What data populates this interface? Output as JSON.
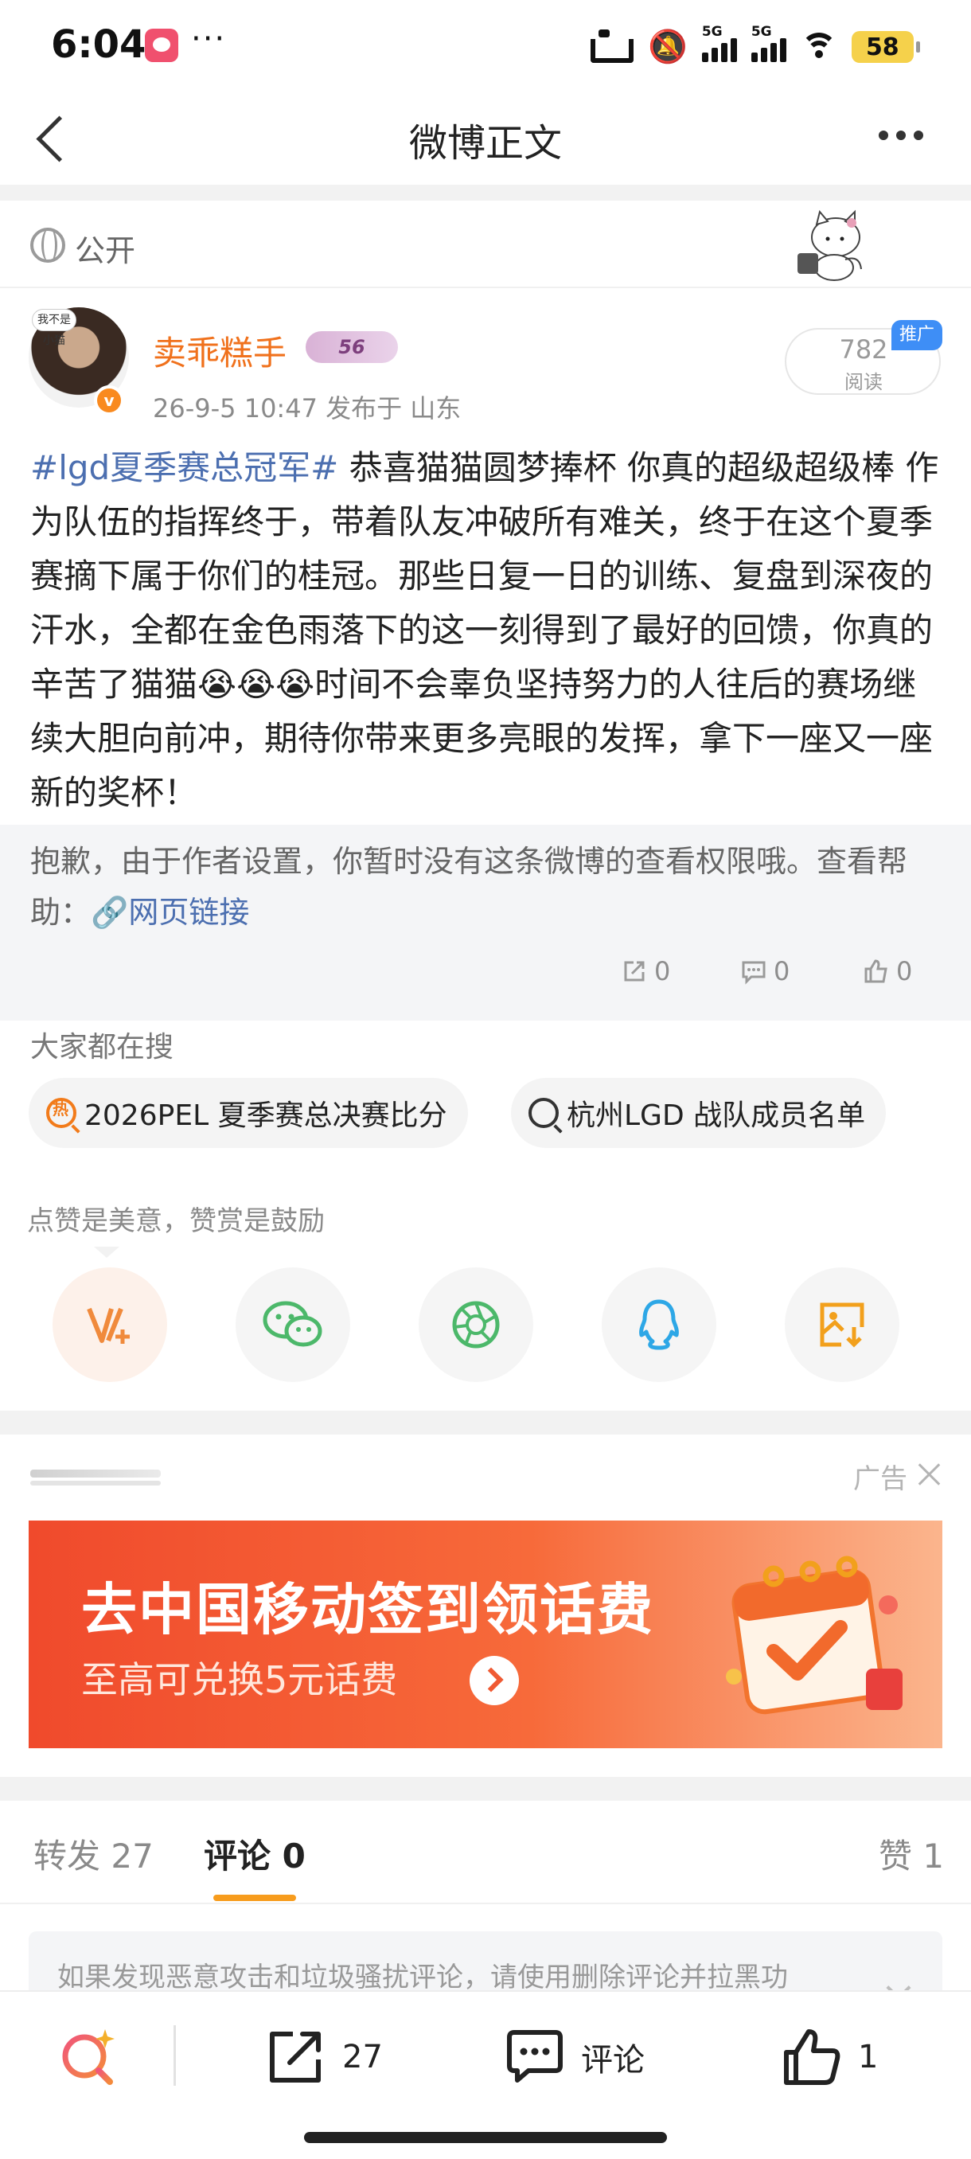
{
  "status_bar": {
    "time": "6:04",
    "more": "···",
    "network_1": "5G",
    "network_2": "5G",
    "battery": "58"
  },
  "nav": {
    "title": "微博正文"
  },
  "post": {
    "visibility": "公开",
    "author": "卖乖糕手",
    "avatar_tag": "我不是小猫",
    "level": "56",
    "verify_mark": "v",
    "meta": "26-9-5 10:47   发布于 山东",
    "views_count": "782",
    "views_label": "阅读",
    "promo_tag": "推广",
    "hashtag": "#lgd夏季赛总冠军#",
    "body": " 恭喜猫猫圆梦捧杯 你真的超级超级棒 作为队伍的指挥终于，带着队友冲破所有难关，终于在这个夏季赛摘下属于你们的桂冠。那些日复一日的训练、复盘到深夜的汗水，全都在金色雨落下的这一刻得到了最好的回馈，你真的辛苦了猫猫😭😭😭时间不会辜负坚持努力的人往后的赛场继续大胆向前冲，期待你带来更多亮眼的发挥，拿下一座又一座新的奖杯！"
  },
  "notice": {
    "text": "抱歉，由于作者设置，你暂时没有这条微博的查看权限哦。查看帮助：",
    "link": "网页链接",
    "reposts": "0",
    "comments": "0",
    "likes": "0"
  },
  "search": {
    "title": "大家都在搜",
    "chips": [
      {
        "label": "2026PEL 夏季赛总决赛比分",
        "icon": "hot-search-icon",
        "badge": "热"
      },
      {
        "label": "杭州LGD 战队成员名单",
        "icon": "search-icon"
      }
    ]
  },
  "share": {
    "title": "点赞是美意，赞赏是鼓励",
    "targets": [
      "weibo-reward-icon",
      "wechat-icon",
      "moments-icon",
      "qq-icon",
      "save-image-icon"
    ]
  },
  "ad": {
    "label": "广告",
    "headline": "去中国移动签到领话费",
    "subline": "至高可兑换5元话费"
  },
  "tabs": [
    {
      "label": "转发 27"
    },
    {
      "label": "评论 0"
    },
    {
      "label": "赞 1"
    }
  ],
  "comment_hint": "如果发现恶意攻击和垃圾骚扰评论，请使用删除评论并拉黑功",
  "bottom_bar": {
    "repost_count": "27",
    "comment_label": "评论",
    "like_count": "1"
  },
  "colors": {
    "accent_orange": "#f0711c",
    "link_blue": "#4c6fb0",
    "tab_underline": "#f79c1d",
    "ad_red": "#f04a2c"
  }
}
